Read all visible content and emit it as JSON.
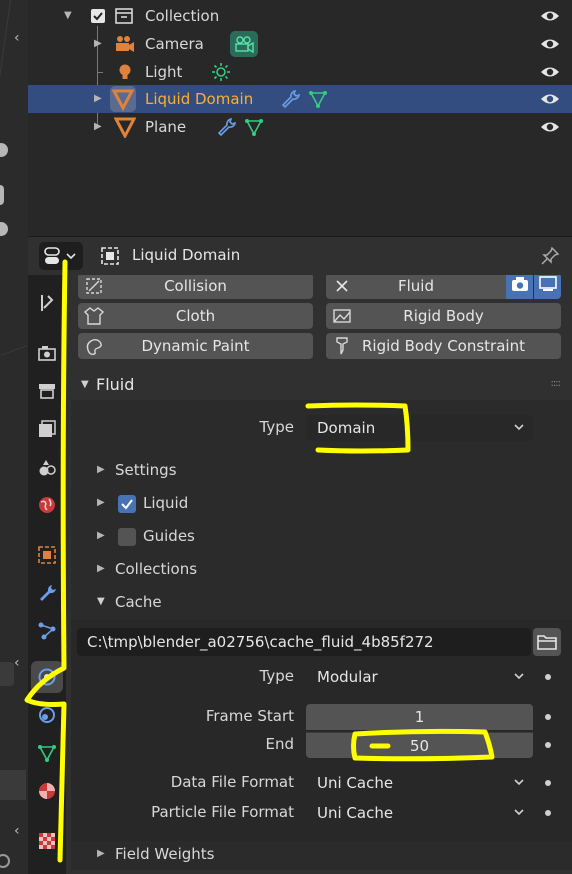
{
  "outliner": {
    "rows": [
      {
        "label": "Collection",
        "kind": "collection"
      },
      {
        "label": "Camera",
        "kind": "camera"
      },
      {
        "label": "Light",
        "kind": "light"
      },
      {
        "label": "Liquid Domain",
        "kind": "mesh",
        "selected": true
      },
      {
        "label": "Plane",
        "kind": "mesh"
      }
    ]
  },
  "properties": {
    "object_name": "Liquid Domain",
    "physics_buttons": {
      "collision": "Collision",
      "fluid": "Fluid",
      "cloth": "Cloth",
      "rigid_body": "Rigid Body",
      "dynamic_paint": "Dynamic Paint",
      "rigid_body_constraint": "Rigid Body Constraint"
    },
    "fluid_panel": {
      "title": "Fluid",
      "type_label": "Type",
      "type_value": "Domain"
    },
    "subpanels": {
      "settings": "Settings",
      "liquid": "Liquid",
      "guides": "Guides",
      "collections": "Collections",
      "cache": "Cache",
      "field_weights": "Field Weights"
    },
    "checkboxes": {
      "liquid_on": true,
      "guides_on": false
    },
    "cache": {
      "directory": "C:\\tmp\\blender_a02756\\cache_fluid_4b85f272",
      "type_label": "Type",
      "type_value": "Modular",
      "frame_start_label": "Frame Start",
      "frame_start_value": "1",
      "end_label": "End",
      "end_value": "50",
      "data_format_label": "Data File Format",
      "data_format_value": "Uni Cache",
      "particle_format_label": "Particle File Format",
      "particle_format_value": "Uni Cache"
    }
  },
  "colors": {
    "selection": "#334d80",
    "selected_text": "#ffaf29",
    "object_orange": "#e0823c",
    "modifier_blue": "#6b9ee8",
    "data_green": "#33cc80",
    "annotation_yellow": "#ffff00"
  },
  "icons": {
    "visibility": "eye-icon",
    "camera": "camera-icon",
    "light": "light-icon",
    "mesh": "mesh-triangle-icon",
    "wrench": "wrench-icon",
    "render": "camera-render-icon",
    "viewport": "monitor-icon",
    "pin": "pin-icon",
    "folder": "folder-icon"
  }
}
